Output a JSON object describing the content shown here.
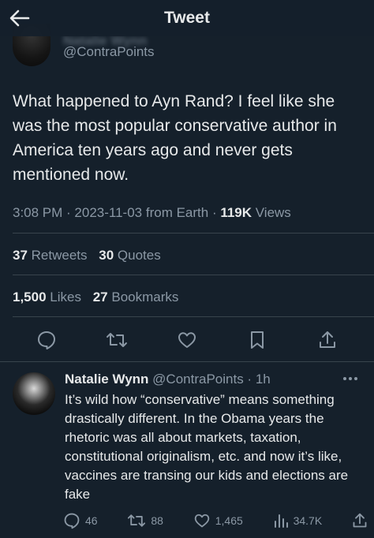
{
  "header": {
    "title": "Tweet"
  },
  "tweet": {
    "author_handle": "@ContraPoints",
    "author_name_obscured": "Natalie Wynn",
    "text": "What happened to Ayn Rand? I feel like she was the most popular conservative author in America ten years ago and never gets mentioned now.",
    "time": "3:08 PM",
    "date": "2023-11-03",
    "source": "from Earth",
    "views_count": "119K",
    "views_label": "Views",
    "retweets_count": "37",
    "retweets_label": "Retweets",
    "quotes_count": "30",
    "quotes_label": "Quotes",
    "likes_count": "1,500",
    "likes_label": "Likes",
    "bookmarks_count": "27",
    "bookmarks_label": "Bookmarks"
  },
  "reply": {
    "name": "Natalie Wynn",
    "handle": "@ContraPoints",
    "age": "1h",
    "text": "It’s wild how “conservative” means something drastically different. In the Obama years the rhetoric was all about markets, taxation, constitutional originalism, etc. and now it’s like, vaccines are transing our kids and elections are fake",
    "replies": "46",
    "retweets": "88",
    "likes": "1,465",
    "views": "34.7K"
  },
  "colors": {
    "background": "#15202b",
    "text_primary": "#e7e9ea",
    "text_secondary": "#8b98a5",
    "divider": "#38444d"
  },
  "icons": [
    "back-arrow-icon",
    "reply-icon",
    "retweet-icon",
    "like-icon",
    "bookmark-icon",
    "share-icon",
    "more-icon",
    "views-icon"
  ]
}
